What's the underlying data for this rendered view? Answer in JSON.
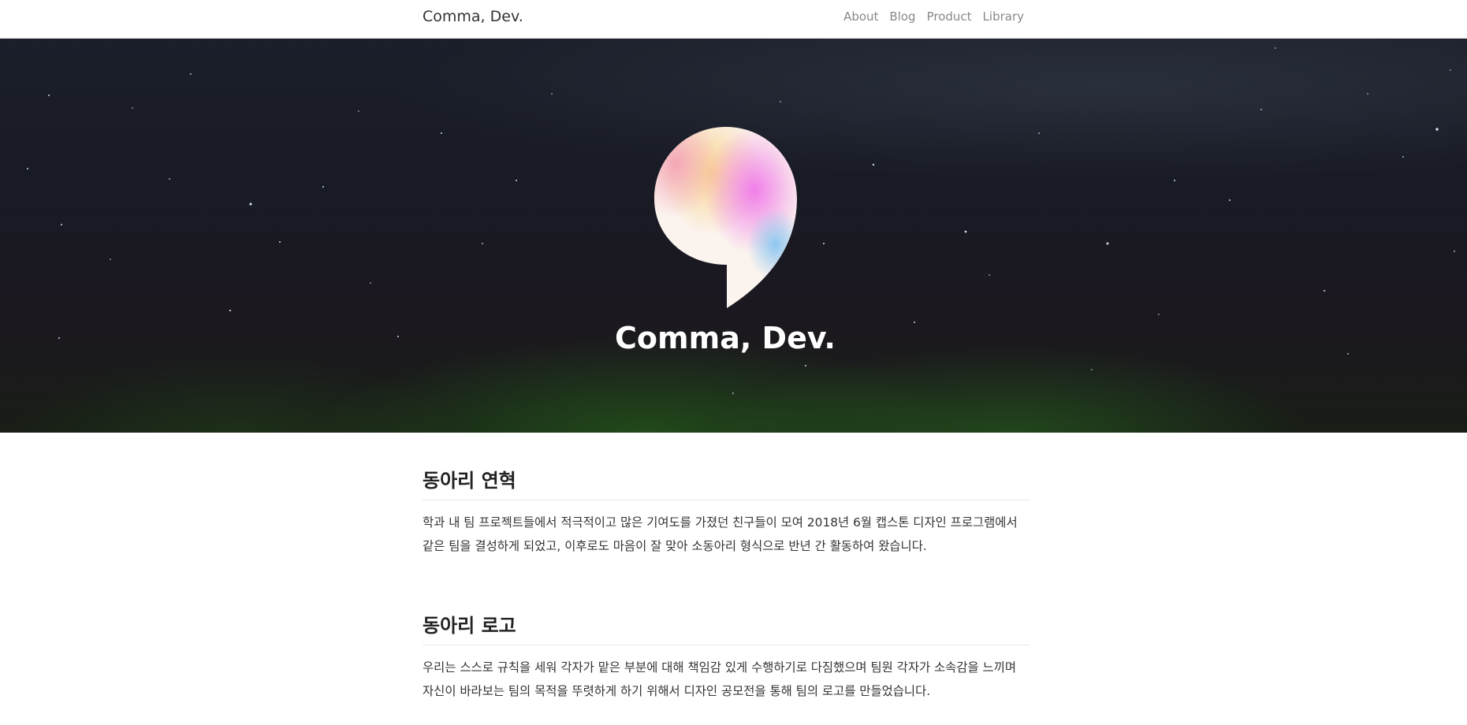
{
  "navbar": {
    "brand": "Comma, Dev.",
    "links": [
      "About",
      "Blog",
      "Product",
      "Library"
    ]
  },
  "hero": {
    "title": "Comma, Dev.",
    "logo_icon": "comma-logo-icon"
  },
  "sections": [
    {
      "title": "동아리 연혁",
      "text": "학과 내 팀 프로젝트들에서 적극적이고 많은 기여도를 가졌던 친구들이 모여 2018년 6월 캡스톤 디자인 프로그램에서 같은 팀을 결성하게 되었고, 이후로도 마음이 잘 맞아 소동아리 형식으로 반년 간 활동하여 왔습니다."
    },
    {
      "title": "동아리 로고",
      "text": "우리는 스스로 규칙을 세워 각자가 맡은 부분에 대해 책임감 있게 수행하기로 다짐했으며 팀원 각자가 소속감을 느끼며 자신이 바라보는 팀의 목적을 뚜렷하게 하기 위해서 디자인 공모전을 통해 팀의 로고를 만들었습니다."
    }
  ],
  "colors": {
    "hero_background": "#181a24",
    "hero_glow": "#2a6e1e",
    "nav_link": "#888888",
    "heading": "#222222"
  }
}
